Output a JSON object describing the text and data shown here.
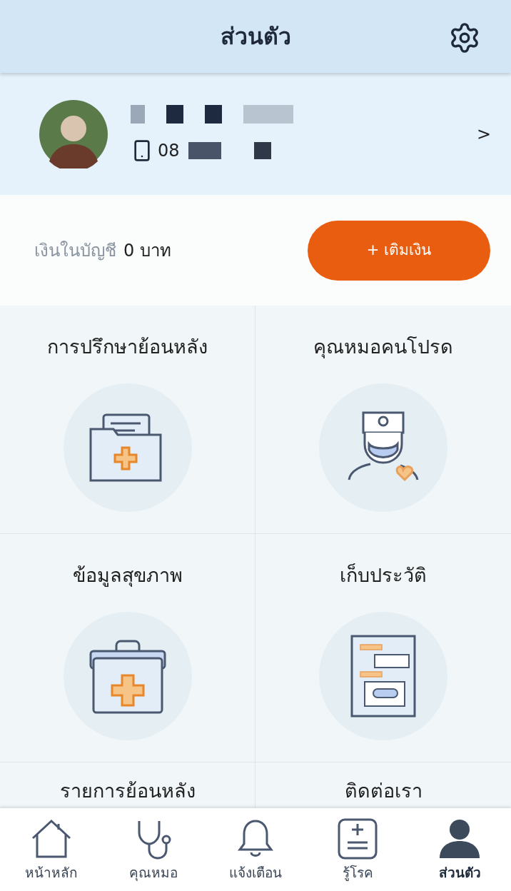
{
  "header": {
    "title": "ส่วนตัว"
  },
  "profile": {
    "phone_prefix": "08",
    "chevron": ">"
  },
  "balance": {
    "label": "เงินในบัญชี",
    "amount": "0 บาท",
    "topup_button": "+ เติมเงิน"
  },
  "menu": [
    {
      "label": "การปรึกษาย้อนหลัง",
      "kind": "folder"
    },
    {
      "label": "คุณหมอคนโปรด",
      "kind": "doctor"
    },
    {
      "label": "ข้อมูลสุขภาพ",
      "kind": "kit"
    },
    {
      "label": "เก็บประวัติ",
      "kind": "record"
    },
    {
      "label": "รายการย้อนหลัง",
      "kind": "none"
    },
    {
      "label": "ติดต่อเรา",
      "kind": "none"
    }
  ],
  "nav": [
    {
      "label": "หน้าหลัก",
      "kind": "home",
      "selected": false
    },
    {
      "label": "คุณหมอ",
      "kind": "stethoscope",
      "selected": false
    },
    {
      "label": "แจ้งเตือน",
      "kind": "bell",
      "selected": false
    },
    {
      "label": "รู้โรค",
      "kind": "disease",
      "selected": false
    },
    {
      "label": "ส่วนตัว",
      "kind": "person",
      "selected": true
    }
  ]
}
